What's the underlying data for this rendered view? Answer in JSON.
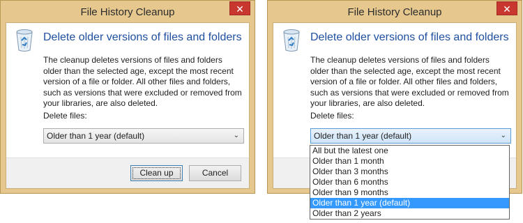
{
  "dialogs": {
    "left": {
      "title": "File History Cleanup",
      "close_label": "✕",
      "heading": "Delete older versions of files and folders",
      "description": "The cleanup deletes versions of files and folders older than the selected age, except the most recent version of a file or folder. All other files and folders, such as versions that were excluded or removed from your libraries, are also deleted.",
      "delete_files_label": "Delete files:",
      "selected_option": "Older than 1 year (default)",
      "cleanup_button": "Clean up",
      "cancel_button": "Cancel"
    },
    "right": {
      "title": "File History Cleanup",
      "close_label": "✕",
      "heading": "Delete older versions of files and folders",
      "description": "The cleanup deletes versions of files and folders older than the selected age, except the most recent version of a file or folder. All other files and folders, such as versions that were excluded or removed from your libraries, are also deleted.",
      "delete_files_label": "Delete files:",
      "selected_option": "Older than 1 year (default)",
      "options": [
        "All but the latest one",
        "Older than 1 month",
        "Older than 3 months",
        "Older than 6 months",
        "Older than 9 months",
        "Older than 1 year (default)",
        "Older than 2 years"
      ],
      "highlighted_option": "Older than 1 year (default)"
    }
  },
  "icons": {
    "recycle_bin": "recycle-bin-icon",
    "dropdown_arrow": "chevron-down-icon"
  },
  "colors": {
    "frame": "#e6c88f",
    "close": "#c7372f",
    "heading": "#1f4fa0",
    "selection": "#3399ff"
  }
}
